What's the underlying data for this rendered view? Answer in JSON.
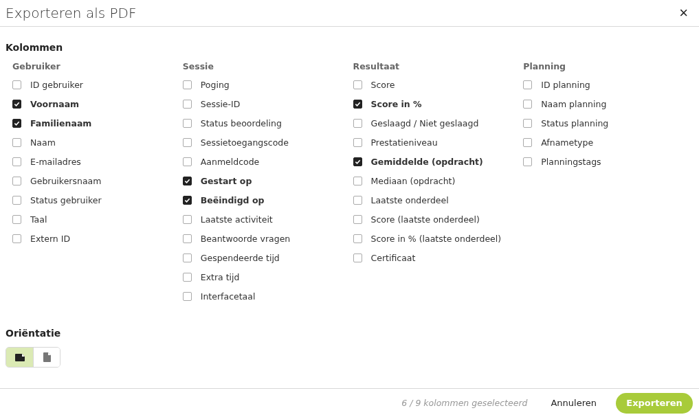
{
  "dialog": {
    "title": "Exporteren als PDF",
    "close": "×"
  },
  "columns_section": {
    "heading": "Kolommen",
    "groups": [
      {
        "title": "Gebruiker",
        "items": [
          {
            "label": "ID gebruiker",
            "checked": false
          },
          {
            "label": "Voornaam",
            "checked": true
          },
          {
            "label": "Familienaam",
            "checked": true
          },
          {
            "label": "Naam",
            "checked": false
          },
          {
            "label": "E-mailadres",
            "checked": false
          },
          {
            "label": "Gebruikersnaam",
            "checked": false
          },
          {
            "label": "Status gebruiker",
            "checked": false
          },
          {
            "label": "Taal",
            "checked": false
          },
          {
            "label": "Extern ID",
            "checked": false
          }
        ]
      },
      {
        "title": "Sessie",
        "items": [
          {
            "label": "Poging",
            "checked": false
          },
          {
            "label": "Sessie-ID",
            "checked": false
          },
          {
            "label": "Status beoordeling",
            "checked": false
          },
          {
            "label": "Sessietoegangscode",
            "checked": false
          },
          {
            "label": "Aanmeldcode",
            "checked": false
          },
          {
            "label": "Gestart op",
            "checked": true
          },
          {
            "label": "Beëindigd op",
            "checked": true
          },
          {
            "label": "Laatste activiteit",
            "checked": false
          },
          {
            "label": "Beantwoorde vragen",
            "checked": false
          },
          {
            "label": "Gespendeerde tijd",
            "checked": false
          },
          {
            "label": "Extra tijd",
            "checked": false
          },
          {
            "label": "Interfacetaal",
            "checked": false
          }
        ]
      },
      {
        "title": "Resultaat",
        "items": [
          {
            "label": "Score",
            "checked": false
          },
          {
            "label": "Score in %",
            "checked": true
          },
          {
            "label": "Geslaagd / Niet geslaagd",
            "checked": false
          },
          {
            "label": "Prestatieniveau",
            "checked": false
          },
          {
            "label": "Gemiddelde (opdracht)",
            "checked": true
          },
          {
            "label": "Mediaan (opdracht)",
            "checked": false
          },
          {
            "label": "Laatste onderdeel",
            "checked": false
          },
          {
            "label": "Score (laatste onderdeel)",
            "checked": false
          },
          {
            "label": "Score in % (laatste onderdeel)",
            "checked": false
          },
          {
            "label": "Certificaat",
            "checked": false
          }
        ]
      },
      {
        "title": "Planning",
        "items": [
          {
            "label": "ID planning",
            "checked": false
          },
          {
            "label": "Naam planning",
            "checked": false
          },
          {
            "label": "Status planning",
            "checked": false
          },
          {
            "label": "Afnametype",
            "checked": false
          },
          {
            "label": "Planningstags",
            "checked": false
          }
        ]
      }
    ]
  },
  "orientation": {
    "heading": "Oriëntatie",
    "options": [
      {
        "kind": "landscape",
        "selected": true
      },
      {
        "kind": "portrait",
        "selected": false
      }
    ]
  },
  "footer": {
    "status": "6 / 9 kolommen geselecteerd",
    "cancel": "Annuleren",
    "submit": "Exporteren"
  }
}
